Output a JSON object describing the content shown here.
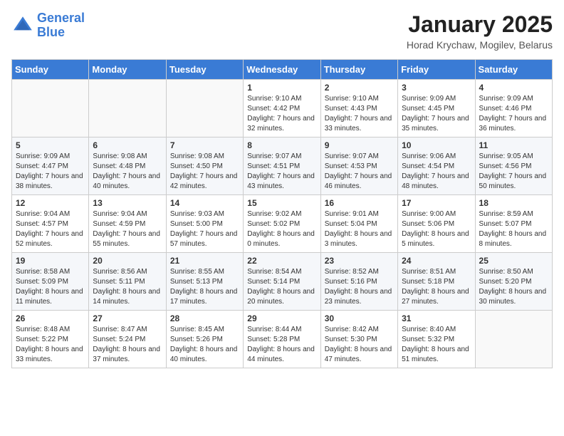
{
  "logo": {
    "line1": "General",
    "line2": "Blue"
  },
  "title": "January 2025",
  "subtitle": "Horad Krychaw, Mogilev, Belarus",
  "days_of_week": [
    "Sunday",
    "Monday",
    "Tuesday",
    "Wednesday",
    "Thursday",
    "Friday",
    "Saturday"
  ],
  "weeks": [
    [
      {
        "day": "",
        "detail": ""
      },
      {
        "day": "",
        "detail": ""
      },
      {
        "day": "",
        "detail": ""
      },
      {
        "day": "1",
        "detail": "Sunrise: 9:10 AM\nSunset: 4:42 PM\nDaylight: 7 hours and 32 minutes."
      },
      {
        "day": "2",
        "detail": "Sunrise: 9:10 AM\nSunset: 4:43 PM\nDaylight: 7 hours and 33 minutes."
      },
      {
        "day": "3",
        "detail": "Sunrise: 9:09 AM\nSunset: 4:45 PM\nDaylight: 7 hours and 35 minutes."
      },
      {
        "day": "4",
        "detail": "Sunrise: 9:09 AM\nSunset: 4:46 PM\nDaylight: 7 hours and 36 minutes."
      }
    ],
    [
      {
        "day": "5",
        "detail": "Sunrise: 9:09 AM\nSunset: 4:47 PM\nDaylight: 7 hours and 38 minutes."
      },
      {
        "day": "6",
        "detail": "Sunrise: 9:08 AM\nSunset: 4:48 PM\nDaylight: 7 hours and 40 minutes."
      },
      {
        "day": "7",
        "detail": "Sunrise: 9:08 AM\nSunset: 4:50 PM\nDaylight: 7 hours and 42 minutes."
      },
      {
        "day": "8",
        "detail": "Sunrise: 9:07 AM\nSunset: 4:51 PM\nDaylight: 7 hours and 43 minutes."
      },
      {
        "day": "9",
        "detail": "Sunrise: 9:07 AM\nSunset: 4:53 PM\nDaylight: 7 hours and 46 minutes."
      },
      {
        "day": "10",
        "detail": "Sunrise: 9:06 AM\nSunset: 4:54 PM\nDaylight: 7 hours and 48 minutes."
      },
      {
        "day": "11",
        "detail": "Sunrise: 9:05 AM\nSunset: 4:56 PM\nDaylight: 7 hours and 50 minutes."
      }
    ],
    [
      {
        "day": "12",
        "detail": "Sunrise: 9:04 AM\nSunset: 4:57 PM\nDaylight: 7 hours and 52 minutes."
      },
      {
        "day": "13",
        "detail": "Sunrise: 9:04 AM\nSunset: 4:59 PM\nDaylight: 7 hours and 55 minutes."
      },
      {
        "day": "14",
        "detail": "Sunrise: 9:03 AM\nSunset: 5:00 PM\nDaylight: 7 hours and 57 minutes."
      },
      {
        "day": "15",
        "detail": "Sunrise: 9:02 AM\nSunset: 5:02 PM\nDaylight: 8 hours and 0 minutes."
      },
      {
        "day": "16",
        "detail": "Sunrise: 9:01 AM\nSunset: 5:04 PM\nDaylight: 8 hours and 3 minutes."
      },
      {
        "day": "17",
        "detail": "Sunrise: 9:00 AM\nSunset: 5:06 PM\nDaylight: 8 hours and 5 minutes."
      },
      {
        "day": "18",
        "detail": "Sunrise: 8:59 AM\nSunset: 5:07 PM\nDaylight: 8 hours and 8 minutes."
      }
    ],
    [
      {
        "day": "19",
        "detail": "Sunrise: 8:58 AM\nSunset: 5:09 PM\nDaylight: 8 hours and 11 minutes."
      },
      {
        "day": "20",
        "detail": "Sunrise: 8:56 AM\nSunset: 5:11 PM\nDaylight: 8 hours and 14 minutes."
      },
      {
        "day": "21",
        "detail": "Sunrise: 8:55 AM\nSunset: 5:13 PM\nDaylight: 8 hours and 17 minutes."
      },
      {
        "day": "22",
        "detail": "Sunrise: 8:54 AM\nSunset: 5:14 PM\nDaylight: 8 hours and 20 minutes."
      },
      {
        "day": "23",
        "detail": "Sunrise: 8:52 AM\nSunset: 5:16 PM\nDaylight: 8 hours and 23 minutes."
      },
      {
        "day": "24",
        "detail": "Sunrise: 8:51 AM\nSunset: 5:18 PM\nDaylight: 8 hours and 27 minutes."
      },
      {
        "day": "25",
        "detail": "Sunrise: 8:50 AM\nSunset: 5:20 PM\nDaylight: 8 hours and 30 minutes."
      }
    ],
    [
      {
        "day": "26",
        "detail": "Sunrise: 8:48 AM\nSunset: 5:22 PM\nDaylight: 8 hours and 33 minutes."
      },
      {
        "day": "27",
        "detail": "Sunrise: 8:47 AM\nSunset: 5:24 PM\nDaylight: 8 hours and 37 minutes."
      },
      {
        "day": "28",
        "detail": "Sunrise: 8:45 AM\nSunset: 5:26 PM\nDaylight: 8 hours and 40 minutes."
      },
      {
        "day": "29",
        "detail": "Sunrise: 8:44 AM\nSunset: 5:28 PM\nDaylight: 8 hours and 44 minutes."
      },
      {
        "day": "30",
        "detail": "Sunrise: 8:42 AM\nSunset: 5:30 PM\nDaylight: 8 hours and 47 minutes."
      },
      {
        "day": "31",
        "detail": "Sunrise: 8:40 AM\nSunset: 5:32 PM\nDaylight: 8 hours and 51 minutes."
      },
      {
        "day": "",
        "detail": ""
      }
    ]
  ]
}
